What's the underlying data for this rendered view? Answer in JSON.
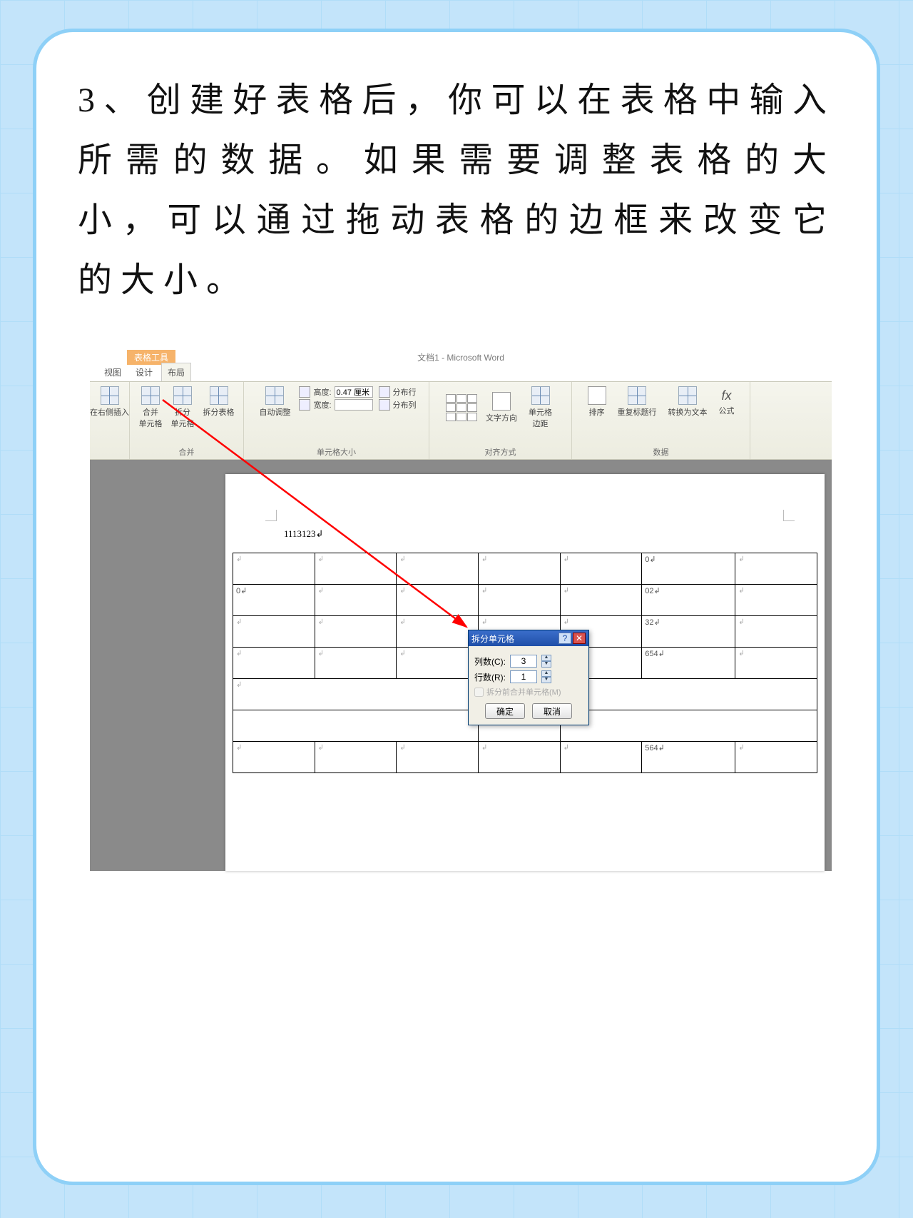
{
  "instruction_text": "3、创建好表格后，你可以在表格中输入所需的数据。如果需要调整表格的大小，可以通过拖动表格的边框来改变它的大小。",
  "word": {
    "context_tab": "表格工具",
    "window_title": "文档1 - Microsoft Word",
    "tabs": {
      "view": "视图",
      "design": "设计",
      "layout": "布局"
    },
    "ribbon": {
      "insert_right": "在右侧插入",
      "merge_cells": "合并\n单元格",
      "split_cells": "拆分\n单元格",
      "split_table": "拆分表格",
      "group_merge": "合并",
      "autofit": "自动调整",
      "height_label": "高度:",
      "height_val": "0.47 厘米",
      "width_label": "宽度:",
      "width_val": "",
      "dist_rows": "分布行",
      "dist_cols": "分布列",
      "group_size": "单元格大小",
      "text_dir": "文字方向",
      "cell_margins": "单元格\n边距",
      "group_align": "对齐方式",
      "sort": "排序",
      "repeat_header": "重复标题行",
      "convert_text": "转换为文本",
      "formula": "公式",
      "fx": "fx",
      "group_data": "数据"
    },
    "doc_text": "1113123",
    "table_values": {
      "r0c5": "0",
      "r1c0": "0",
      "r1c5": "02",
      "r2c5": "32",
      "r3c5": "654",
      "r6c5": "564"
    },
    "dialog": {
      "title": "拆分单元格",
      "cols_label": "列数(C):",
      "cols_val": "3",
      "rows_label": "行数(R):",
      "rows_val": "1",
      "merge_before": "拆分前合并单元格(M)",
      "ok": "确定",
      "cancel": "取消"
    }
  }
}
